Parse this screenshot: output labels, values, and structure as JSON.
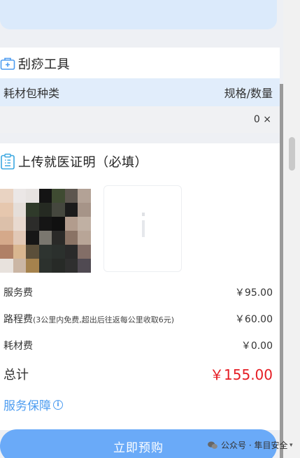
{
  "scraping_tools": {
    "title": "刮痧工具",
    "col_kind": "耗材包种类",
    "col_spec": "规格/数量",
    "row_qty": "0 ×"
  },
  "upload": {
    "title": "上传就医证明（必填）"
  },
  "fees": {
    "service_label": "服务费",
    "service_value": "￥95.00",
    "travel_label": "路程费",
    "travel_note": "(3公里内免费,超出后往返每公里收取6元)",
    "travel_value": "￥60.00",
    "material_label": "耗材费",
    "material_value": "￥0.00",
    "total_label": "总计",
    "total_value": "￥155.00"
  },
  "guarantee": {
    "label": "服务保障",
    "icon": "info-circle-icon"
  },
  "actions": {
    "book_label": "立即预购"
  },
  "watermark": {
    "text": "公众号 · 隼目安全"
  },
  "colors": {
    "accent": "#4d9cf0",
    "button": "#6aaaf8",
    "price_red": "#e51c23",
    "table_head_bg": "#e1edfb"
  }
}
